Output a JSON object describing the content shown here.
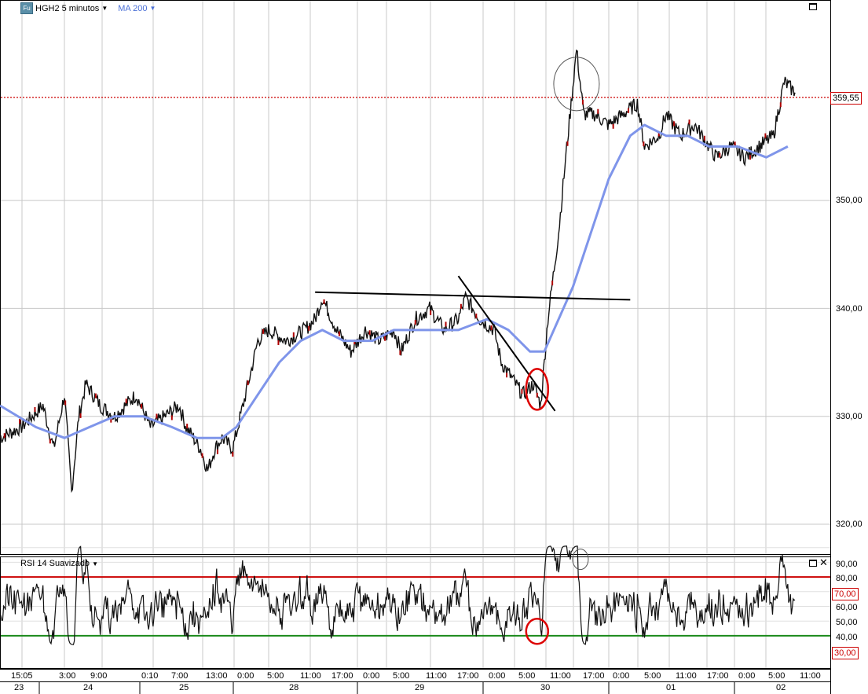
{
  "header": {
    "symbol": "HGH2 5 minutos",
    "symbol_icon": "Fu",
    "indicator": "MA 200",
    "indicator_color": "#4a6fd6"
  },
  "price_panel": {
    "last_price_label": "359,55",
    "y_ticks": [
      "320,00",
      "330,00",
      "340,00",
      "350,00"
    ]
  },
  "rsi_panel": {
    "title": "RSI 14 Suavizado",
    "y_ticks": [
      "40,00",
      "50,00",
      "60,00",
      "80,00",
      "90,00"
    ],
    "upper_label": "70,00",
    "lower_label": "30,00",
    "upper_color": "#cc0000",
    "lower_color": "#1a8a1a"
  },
  "x_axis": {
    "time_ticks": [
      "15:05",
      "3:00",
      "9:00",
      "0:10",
      "7:00",
      "13:00",
      "0:00",
      "5:00",
      "11:00",
      "17:00",
      "0:00",
      "5:00",
      "11:00",
      "17:00",
      "0:00",
      "5:00",
      "11:00",
      "17:00",
      "0:00",
      "5:00",
      "11:00",
      "17:00",
      "0:00",
      "5:00",
      "11:00"
    ],
    "day_ticks": [
      "23",
      "24",
      "25",
      "28",
      "29",
      "30",
      "01",
      "02"
    ]
  },
  "chart_data": [
    {
      "type": "line",
      "title": "HGH2 5 minutos",
      "note_series": [
        "price",
        "MA 200"
      ],
      "ylim": [
        317,
        365
      ],
      "price_reference": 359.55,
      "price_path": [
        [
          0,
          328
        ],
        [
          6,
          329
        ],
        [
          12,
          331
        ],
        [
          15,
          327
        ],
        [
          18,
          332
        ],
        [
          20,
          323
        ],
        [
          22,
          330
        ],
        [
          24,
          333
        ],
        [
          28,
          331
        ],
        [
          32,
          330
        ],
        [
          38,
          332
        ],
        [
          42,
          329
        ],
        [
          46,
          330
        ],
        [
          50,
          331
        ],
        [
          52,
          329
        ],
        [
          56,
          327
        ],
        [
          58,
          325
        ],
        [
          60,
          327
        ],
        [
          62,
          328
        ],
        [
          65,
          327
        ],
        [
          70,
          334
        ],
        [
          72,
          337
        ],
        [
          75,
          338
        ],
        [
          80,
          337
        ],
        [
          85,
          338
        ],
        [
          88,
          339
        ],
        [
          90,
          341
        ],
        [
          94,
          338
        ],
        [
          98,
          336
        ],
        [
          102,
          338
        ],
        [
          106,
          337
        ],
        [
          110,
          338
        ],
        [
          112,
          336
        ],
        [
          116,
          339
        ],
        [
          120,
          340
        ],
        [
          124,
          338
        ],
        [
          128,
          339
        ],
        [
          130,
          341
        ],
        [
          134,
          339
        ],
        [
          138,
          338
        ],
        [
          140,
          335
        ],
        [
          144,
          333
        ],
        [
          146,
          332
        ],
        [
          149,
          333
        ],
        [
          151,
          331
        ],
        [
          153,
          339
        ],
        [
          156,
          347
        ],
        [
          158,
          354
        ],
        [
          161,
          364
        ],
        [
          163,
          358
        ],
        [
          166,
          358
        ],
        [
          170,
          357
        ],
        [
          174,
          358
        ],
        [
          178,
          359
        ],
        [
          180,
          355
        ],
        [
          184,
          356
        ],
        [
          186,
          358
        ],
        [
          190,
          356
        ],
        [
          194,
          357
        ],
        [
          198,
          355
        ],
        [
          200,
          354
        ],
        [
          204,
          355
        ],
        [
          208,
          354
        ],
        [
          212,
          355
        ],
        [
          216,
          356
        ],
        [
          219,
          361
        ],
        [
          222,
          360
        ]
      ],
      "ma_path": [
        [
          0,
          331
        ],
        [
          10,
          329
        ],
        [
          18,
          328
        ],
        [
          25,
          329
        ],
        [
          32,
          330
        ],
        [
          40,
          330
        ],
        [
          48,
          329
        ],
        [
          55,
          328
        ],
        [
          62,
          328
        ],
        [
          66,
          329
        ],
        [
          72,
          332
        ],
        [
          78,
          335
        ],
        [
          84,
          337
        ],
        [
          90,
          338
        ],
        [
          96,
          337
        ],
        [
          104,
          337
        ],
        [
          110,
          338
        ],
        [
          118,
          338
        ],
        [
          128,
          338
        ],
        [
          136,
          339
        ],
        [
          142,
          338
        ],
        [
          148,
          336
        ],
        [
          152,
          336
        ],
        [
          160,
          342
        ],
        [
          170,
          352
        ],
        [
          176,
          356
        ],
        [
          180,
          357
        ],
        [
          186,
          356
        ],
        [
          192,
          356
        ],
        [
          198,
          355
        ],
        [
          206,
          355
        ],
        [
          214,
          354
        ],
        [
          220,
          355
        ]
      ],
      "trendlines": [
        {
          "from": [
            88,
            341.5
          ],
          "to": [
            176,
            340.8
          ]
        },
        {
          "from": [
            128,
            343
          ],
          "to": [
            155,
            330.5
          ]
        }
      ],
      "circles": [
        {
          "at": [
            161,
            360.8
          ],
          "color": "#555555"
        },
        {
          "at": [
            150,
            332.5
          ],
          "color": "#dd0000"
        }
      ]
    },
    {
      "type": "line",
      "title": "RSI 14 Suavizado",
      "ylim": [
        20,
        92
      ],
      "levels": [
        70,
        30
      ],
      "circles": [
        {
          "at": [
            161,
            82
          ],
          "color": "#555555"
        },
        {
          "at": [
            150,
            33
          ],
          "color": "#dd0000"
        }
      ]
    }
  ]
}
